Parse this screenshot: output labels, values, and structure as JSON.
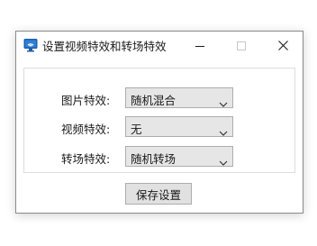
{
  "window": {
    "title": "设置视频特效和转场特效",
    "icon": "monitor-wifi-icon"
  },
  "controls": {
    "minimize_icon": "minimize-icon",
    "maximize_icon": "maximize-icon",
    "close_icon": "close-icon"
  },
  "form": {
    "image_effect": {
      "label": "图片特效:",
      "value": "随机混合"
    },
    "video_effect": {
      "label": "视频特效:",
      "value": "无"
    },
    "transition_effect": {
      "label": "转场特效:",
      "value": "随机转场"
    }
  },
  "buttons": {
    "save_label": "保存设置"
  },
  "colors": {
    "app_icon_blue": "#1e5fa8",
    "combo_bg": "#e6e6e6",
    "button_bg": "#e1e1e1",
    "border": "#adadad"
  }
}
